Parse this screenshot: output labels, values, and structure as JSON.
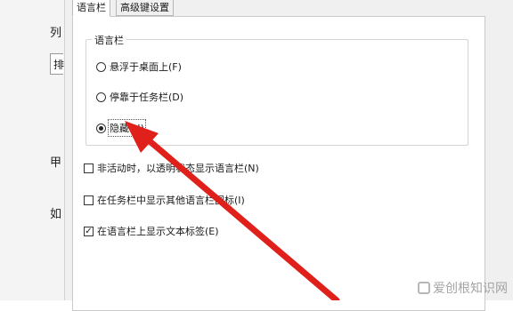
{
  "background": {
    "snippets": [
      "列",
      "排",
      "甲",
      "如"
    ]
  },
  "tabs": [
    {
      "label": "语言栏",
      "active": true
    },
    {
      "label": "高级键设置",
      "active": false
    }
  ],
  "group": {
    "title": "语言栏",
    "options": [
      {
        "label": "悬浮于桌面上(F)",
        "selected": false
      },
      {
        "label": "停靠于任务栏(D)",
        "selected": false
      },
      {
        "label": "隐藏(H)",
        "selected": true
      }
    ]
  },
  "checkboxes": [
    {
      "label": "非活动时，以透明状态显示语言栏(N)",
      "checked": false
    },
    {
      "label": "在任务栏中显示其他语言栏图标(I)",
      "checked": false
    },
    {
      "label": "在语言栏上显示文本标签(E)",
      "checked": true
    }
  ],
  "annotation": {
    "color": "#e0201b"
  },
  "watermark": {
    "text": "爱创根知识网"
  }
}
